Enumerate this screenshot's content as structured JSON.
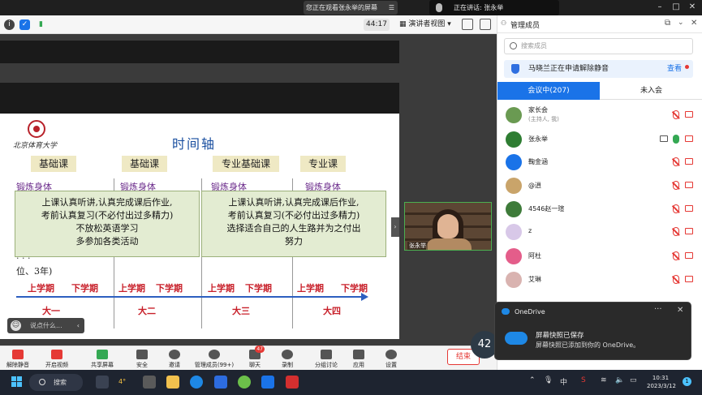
{
  "topbar": {
    "share_notice": "您正在观看张永举的屏幕",
    "speaking": "正在讲话: 张永举"
  },
  "toolbar": {
    "timer": "44:17",
    "view": "演讲者视图"
  },
  "slide": {
    "school": "北京体育大学",
    "title": "时间轴",
    "columns": [
      "基础课",
      "基础课",
      "专业基础课",
      "专业课"
    ],
    "exercise": "锻炼身体",
    "box_left": [
      "上课认真听讲,认真完成课后作业,",
      "考前认真复习(不必付出过多精力)",
      "不放松英语学习",
      "多参加各类活动"
    ],
    "box_right": [
      "上课认真听讲,认真完成课后作业,",
      "考前认真复习(不必付出过多精力)",
      "选择适合自己的人生路并为之付出",
      "努力"
    ],
    "behind_line": "位、3年)",
    "terms": [
      "上学期",
      "下学期"
    ],
    "years": [
      "大一",
      "大二",
      "大三",
      "大四"
    ]
  },
  "chat": {
    "placeholder": "说点什么..."
  },
  "video": {
    "name": "张永举"
  },
  "bottombar": {
    "items": [
      "解除静音",
      "开启视频",
      "共享屏幕",
      "安全",
      "邀请",
      "管理成员(99+)",
      "聊天",
      "录制",
      "分组讨论",
      "应用",
      "设置"
    ],
    "chat_badge": "47",
    "end": "结束"
  },
  "panel": {
    "title": "管理成员",
    "search_placeholder": "搜索成员",
    "notice": "马晓兰正在申请解除静音",
    "notice_action": "查看",
    "tab_in": "会议中(207)",
    "tab_out": "未入会",
    "members": [
      {
        "name": "家长会",
        "role": "(主持人, 我)",
        "color": "#6a9a52"
      },
      {
        "name": "张永举",
        "role": "",
        "color": "#2e7d32"
      },
      {
        "name": "鞠金涵",
        "role": "",
        "color": "#1a73e8"
      },
      {
        "name": "@逍",
        "role": "",
        "color": "#c9a46a"
      },
      {
        "name": "4546赵一瑄",
        "role": "",
        "color": "#3e7b3a"
      },
      {
        "name": "z",
        "role": "",
        "color": "#d8c8e8"
      },
      {
        "name": "阿杜",
        "role": "",
        "color": "#e45d8a"
      },
      {
        "name": "艾琳",
        "role": "",
        "color": "#d9b3b0"
      }
    ]
  },
  "toast": {
    "app": "OneDrive",
    "title": "屏幕快照已保存",
    "body": "屏幕快照已添加到你的 OneDrive。"
  },
  "float_timer": "42",
  "taskbar": {
    "search": "搜索",
    "weather": "4°",
    "ime": "中",
    "time": "10:31",
    "date": "2023/3/12",
    "notif": "1"
  }
}
